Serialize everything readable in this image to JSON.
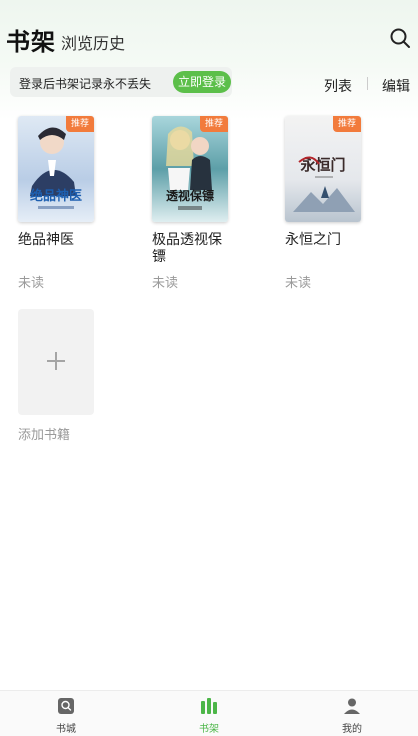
{
  "header": {
    "title": "书架",
    "subtitle": "浏览历史",
    "search_icon": "search-icon"
  },
  "login_bar": {
    "text": "登录后书架记录永不丢失",
    "button": "立即登录"
  },
  "actions": {
    "list": "列表",
    "edit": "编辑"
  },
  "books": [
    {
      "title": "绝品神医",
      "status": "未读",
      "badge": "推荐",
      "cover_text": "绝品神医"
    },
    {
      "title": "极品透视保镖",
      "status": "未读",
      "badge": "推荐",
      "cover_text": "极品透视保镖"
    },
    {
      "title": "永恒之门",
      "status": "未读",
      "badge": "推荐",
      "cover_text": "永恒之门"
    }
  ],
  "add_book": {
    "label": "添加书籍",
    "icon": "plus-icon"
  },
  "tabbar": {
    "items": [
      {
        "label": "书城",
        "icon": "store-icon",
        "active": false
      },
      {
        "label": "书架",
        "icon": "bookshelf-icon",
        "active": true
      },
      {
        "label": "我的",
        "icon": "profile-icon",
        "active": false
      }
    ]
  },
  "colors": {
    "accent": "#5cbf4a",
    "badge": "#f27b3c",
    "muted": "#9a9a9a"
  }
}
